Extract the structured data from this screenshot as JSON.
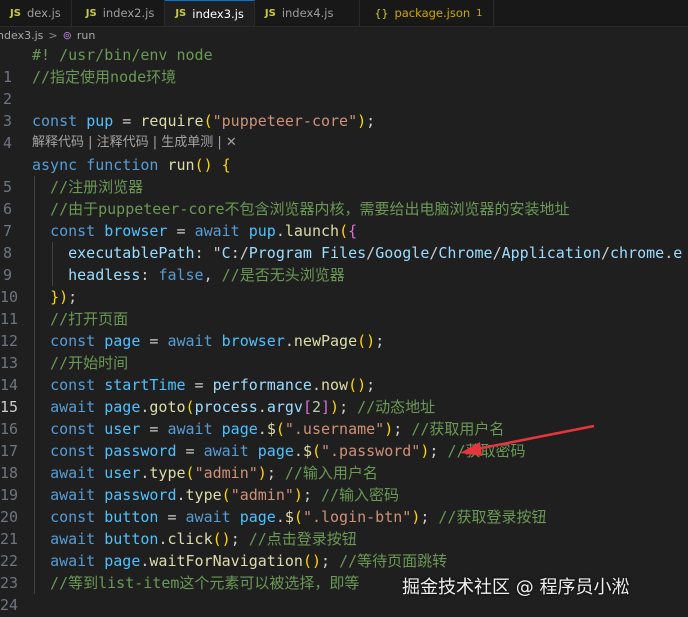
{
  "tabs": [
    {
      "label": "dex.js",
      "icon": "js-file-icon"
    },
    {
      "label": "index2.js",
      "icon": "js-file-icon"
    },
    {
      "label": "index3.js",
      "icon": "js-file-icon",
      "active": true
    },
    {
      "label": "index4.js",
      "icon": "js-file-icon"
    },
    {
      "label": "package.json",
      "icon": "json-file-icon",
      "badge": "1"
    }
  ],
  "breadcrumb": {
    "file": "index3.js",
    "separator": ">",
    "symbol": "run"
  },
  "codelens": {
    "text": "解释代码 | 注释代码 | 生成单测 | ✕"
  },
  "lines": [
    {
      "num": "1",
      "text": "#! /usr/bin/env node"
    },
    {
      "num": "2",
      "text": "//指定使用node环境"
    },
    {
      "num": "3",
      "text": ""
    },
    {
      "num": "4",
      "text": "const pup = require(\"puppeteer-core\");"
    },
    {
      "num": "5",
      "text": "async function run() {"
    },
    {
      "num": "6",
      "text": "  //注册浏览器"
    },
    {
      "num": "7",
      "text": "  //由于puppeteer-core不包含浏览器内核，需要给出电脑浏览器的安装地址"
    },
    {
      "num": "8",
      "text": "  const browser = await pup.launch({"
    },
    {
      "num": "9",
      "text": "    executablePath: \"C:/Program Files/Google/Chrome/Application/chrome.e"
    },
    {
      "num": "10",
      "text": "    headless: false, //是否无头浏览器"
    },
    {
      "num": "11",
      "text": "  });"
    },
    {
      "num": "12",
      "text": "  //打开页面"
    },
    {
      "num": "13",
      "text": "  const page = await browser.newPage();"
    },
    {
      "num": "14",
      "text": "  //开始时间"
    },
    {
      "num": "15",
      "text": "  const startTime = performance.now();"
    },
    {
      "num": "16",
      "text": "  await page.goto(process.argv[2]); //动态地址"
    },
    {
      "num": "17",
      "text": "  const user = await page.$(\".username\"); //获取用户名"
    },
    {
      "num": "18",
      "text": "  const password = await page.$(\".password\"); //获取密码"
    },
    {
      "num": "19",
      "text": "  await user.type(\"admin\"); //输入用户名"
    },
    {
      "num": "20",
      "text": "  await password.type(\"admin\"); //输入密码"
    },
    {
      "num": "21",
      "text": "  const button = await page.$(\".login-btn\"); //获取登录按钮"
    },
    {
      "num": "22",
      "text": "  await button.click(); //点击登录按钮"
    },
    {
      "num": "23",
      "text": "  await page.waitForNavigation(); //等待页面跳转"
    },
    {
      "num": "24",
      "text": "  //等到list-item这个元素可以被选择，即等"
    }
  ],
  "watermark": {
    "text": "掘金技术社区 @ 程序员小淞"
  },
  "colors": {
    "keyword": "#569cd6",
    "control": "#c586c0",
    "variable": "#9cdcfe",
    "function": "#dcdcaa",
    "string": "#ce9178",
    "comment": "#6a9955",
    "arrow": "#e8343d"
  }
}
